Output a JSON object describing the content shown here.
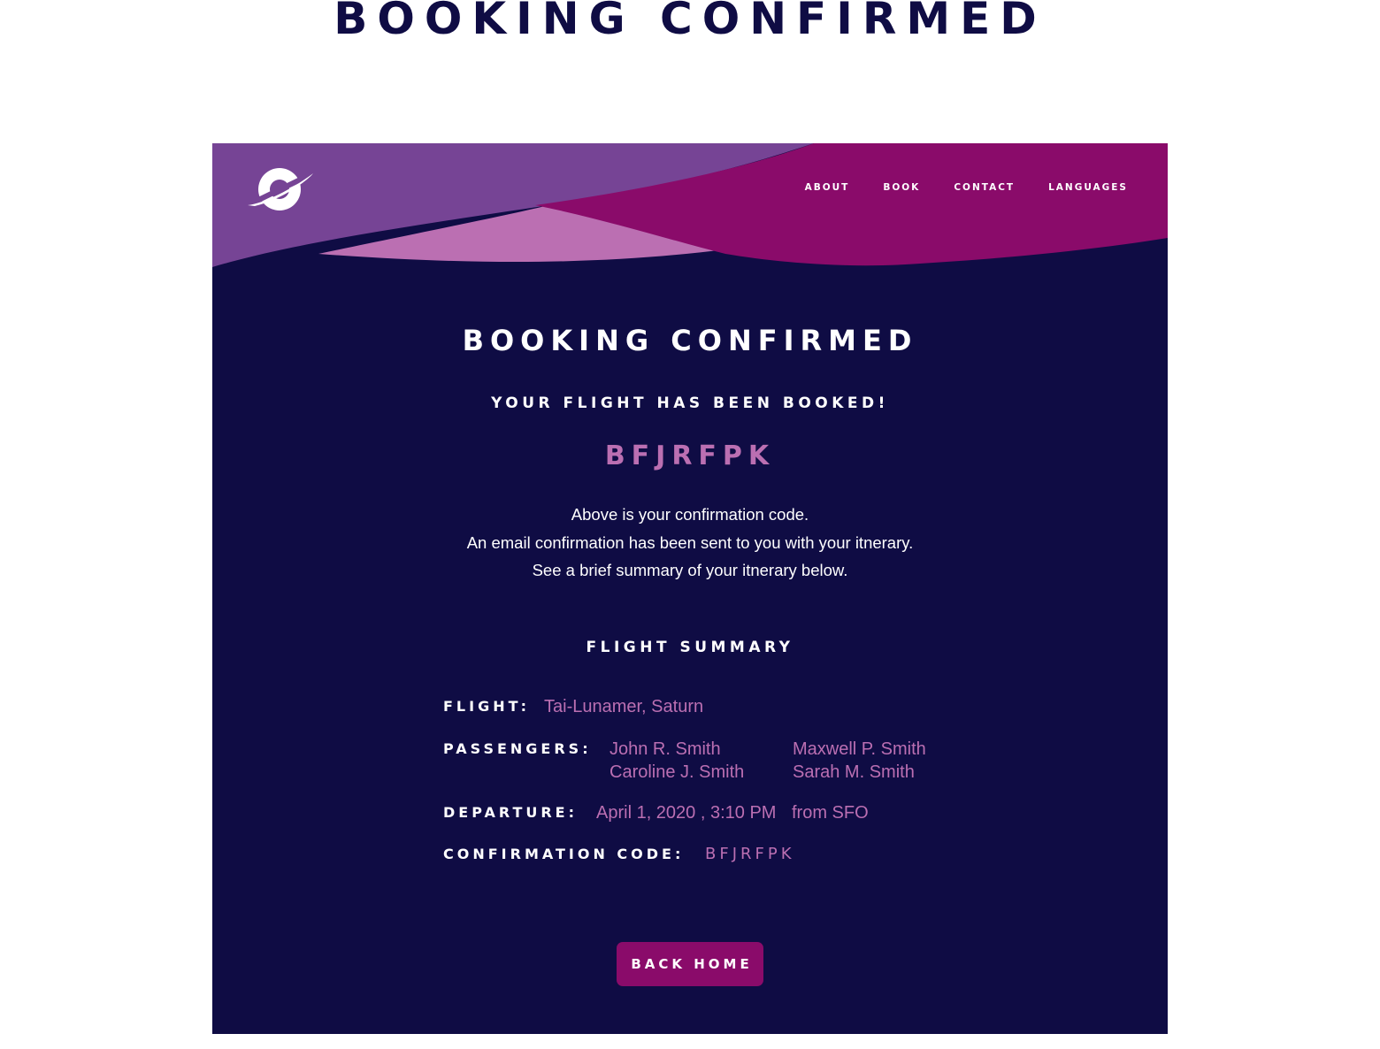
{
  "page": {
    "heading": "BOOKING CONFIRMED"
  },
  "nav": {
    "items": [
      "ABOUT",
      "BOOK",
      "CONTACT",
      "LANGUAGES"
    ]
  },
  "main": {
    "title": "BOOKING CONFIRMED",
    "subtitle": "YOUR FLIGHT HAS BEEN BOOKED!",
    "confirmation_code": "BFJRFPK",
    "lines": [
      "Above is your confirmation code.",
      "An email confirmation has been sent to you with your itnerary.",
      "See a brief summary of your itnerary below."
    ]
  },
  "summary": {
    "heading": "FLIGHT SUMMARY",
    "flight_label": "FLIGHT:",
    "flight_value": "Tai-Lunamer, Saturn",
    "passengers_label": "PASSENGERS:",
    "passengers": [
      "John R. Smith",
      "Maxwell P. Smith",
      "Caroline J. Smith",
      "Sarah M. Smith"
    ],
    "departure_label": "DEPARTURE:",
    "departure_value": "April 1, 2020 , 3:10 PM",
    "departure_from": "from SFO",
    "code_label": "CONFIRMATION CODE:",
    "code_value": "BFJRFPK"
  },
  "actions": {
    "back_home": "BACK HOME"
  },
  "colors": {
    "navy": "#0f0c44",
    "purple": "#764495",
    "pink": "#bb6fb2",
    "magenta": "#8a0b6a",
    "white": "#ffffff"
  }
}
